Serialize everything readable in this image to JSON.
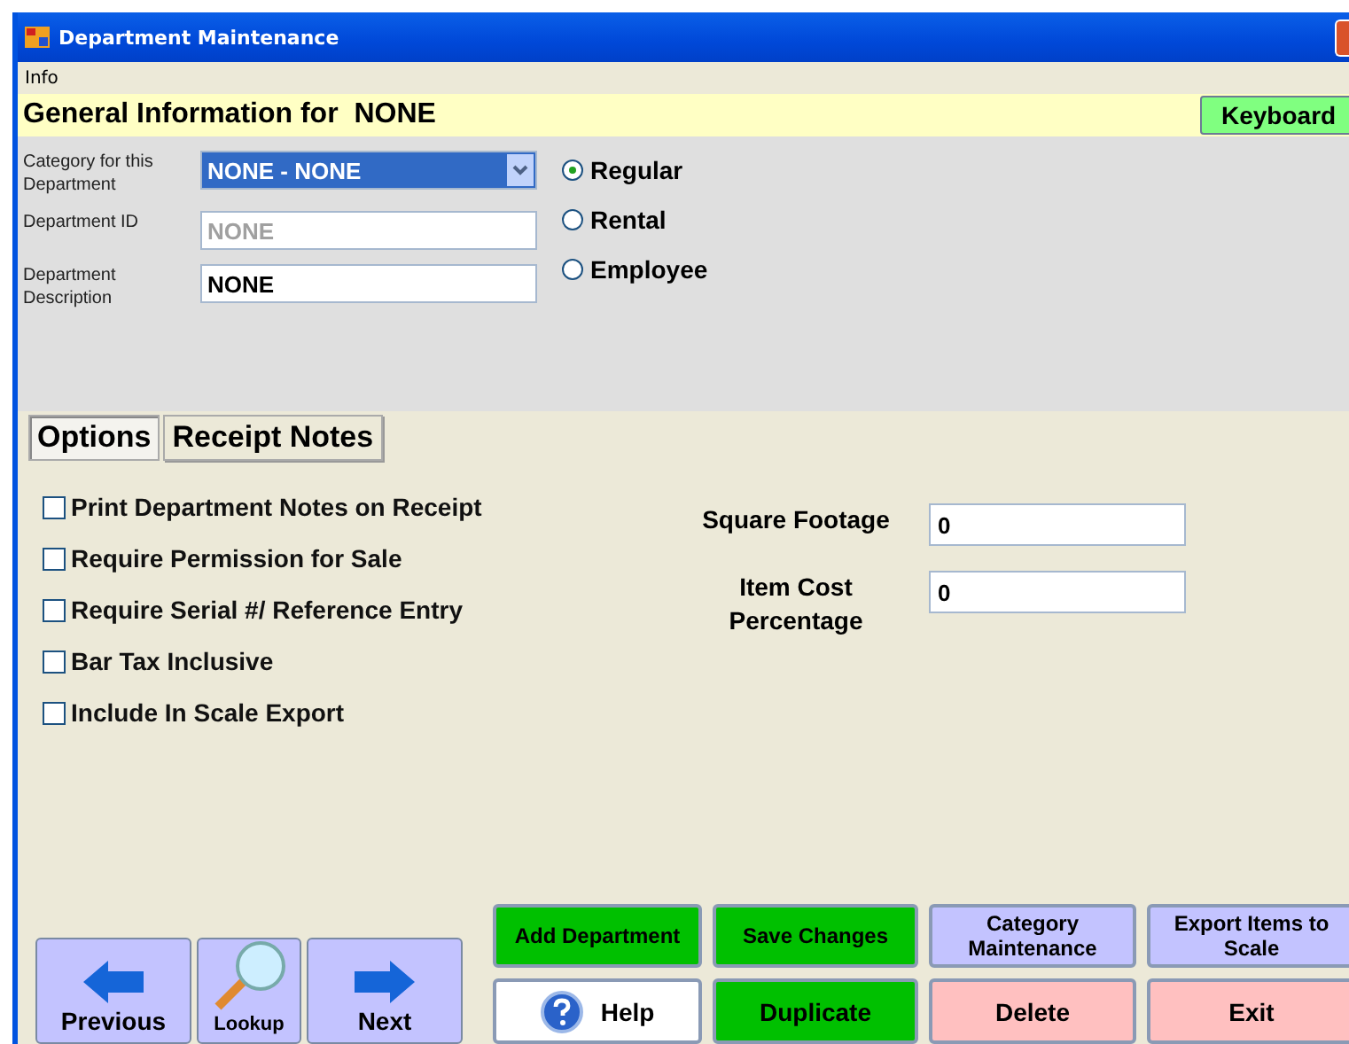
{
  "window": {
    "title": "Department Maintenance"
  },
  "menu": [
    "Info"
  ],
  "header": {
    "title": "General Information for  NONE",
    "keyboard_button": "Keyboard"
  },
  "fields": [
    {
      "kind": "select",
      "label": "Category for this Department",
      "value": "NONE - NONE",
      "disabled": false
    },
    {
      "kind": "text",
      "label": "Department ID",
      "value": "NONE",
      "disabled": true
    },
    {
      "kind": "text",
      "label": "Department Description",
      "value": "NONE",
      "disabled": false
    }
  ],
  "types": [
    {
      "label": "Regular",
      "selected": true
    },
    {
      "label": "Rental",
      "selected": false
    },
    {
      "label": "Employee",
      "selected": false
    }
  ],
  "tabs": [
    {
      "label": "Options",
      "selected": true
    },
    {
      "label": "Receipt Notes",
      "selected": false
    }
  ],
  "options": [
    {
      "label": "Print Department Notes on Receipt",
      "checked": false
    },
    {
      "label": "Require Permission for Sale",
      "checked": false
    },
    {
      "label": "Require Serial #/ Reference Entry",
      "checked": false
    },
    {
      "label": "Bar Tax Inclusive",
      "checked": false
    },
    {
      "label": "Include In Scale Export",
      "checked": false
    }
  ],
  "numbers": [
    {
      "label": "Square Footage",
      "value": "0"
    },
    {
      "label": "Item Cost Percentage",
      "value": "0"
    }
  ],
  "nav_buttons": [
    {
      "label": "Previous",
      "kind": "previous"
    },
    {
      "label": "Lookup",
      "kind": "lookup"
    },
    {
      "label": "Next",
      "kind": "next"
    }
  ],
  "action_buttons": [
    {
      "label": "Add Department",
      "kind": "green"
    },
    {
      "label": "Save Changes",
      "kind": "green"
    },
    {
      "label": "Category Maintenance",
      "kind": "lavender"
    },
    {
      "label": "Export Items to Scale",
      "kind": "lavender"
    },
    {
      "label": "Help",
      "kind": "help"
    },
    {
      "label": "Duplicate",
      "kind": "green"
    },
    {
      "label": "Delete",
      "kind": "pink"
    },
    {
      "label": "Exit",
      "kind": "pink"
    }
  ]
}
